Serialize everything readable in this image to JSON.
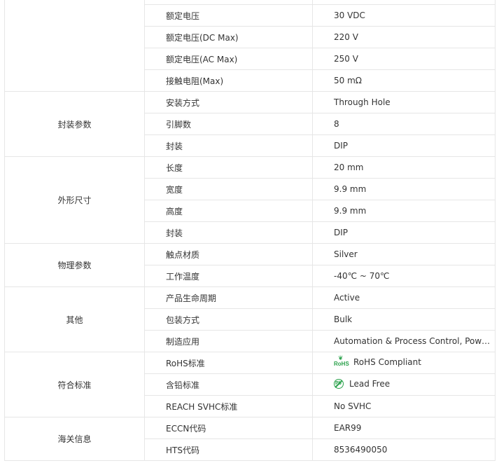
{
  "groups": {
    "electrical": "",
    "package": "封装参数",
    "dimensions": "外形尺寸",
    "physical": "物理参数",
    "other": "其他",
    "compliance": "符合标准",
    "customs": "海关信息"
  },
  "rows": [
    {
      "name": "额定电压",
      "value": "30 VDC"
    },
    {
      "name": "额定电压(DC Max)",
      "value": "220 V"
    },
    {
      "name": "额定电压(AC Max)",
      "value": "250 V"
    },
    {
      "name": "接触电阻(Max)",
      "value": "50 mΩ"
    },
    {
      "name": "安装方式",
      "value": "Through Hole"
    },
    {
      "name": "引脚数",
      "value": "8"
    },
    {
      "name": "封装",
      "value": "DIP"
    },
    {
      "name": "长度",
      "value": "20 mm"
    },
    {
      "name": "宽度",
      "value": "9.9 mm"
    },
    {
      "name": "高度",
      "value": "9.9 mm"
    },
    {
      "name": "封装",
      "value": "DIP"
    },
    {
      "name": "触点材质",
      "value": "Silver"
    },
    {
      "name": "工作温度",
      "value": "-40℃ ~ 70℃"
    },
    {
      "name": "产品生命周期",
      "value": "Active"
    },
    {
      "name": "包装方式",
      "value": "Bulk"
    },
    {
      "name": "制造应用",
      "value": "Automation & Process Control, Pow…"
    },
    {
      "name": "RoHS标准",
      "value": "RoHS Compliant",
      "icon": "rohs-icon"
    },
    {
      "name": "含铅标准",
      "value": "Lead Free",
      "icon": "lead-free-icon"
    },
    {
      "name": "REACH SVHC标准",
      "value": "No SVHC"
    },
    {
      "name": "ECCN代码",
      "value": "EAR99"
    },
    {
      "name": "HTS代码",
      "value": "8536490050"
    }
  ],
  "icons": {
    "rohs_text": "RoHS",
    "pb_text": "Pb"
  },
  "colors": {
    "border": "#e6e6e6",
    "text": "#333333",
    "icon_green": "#2aa14b"
  }
}
